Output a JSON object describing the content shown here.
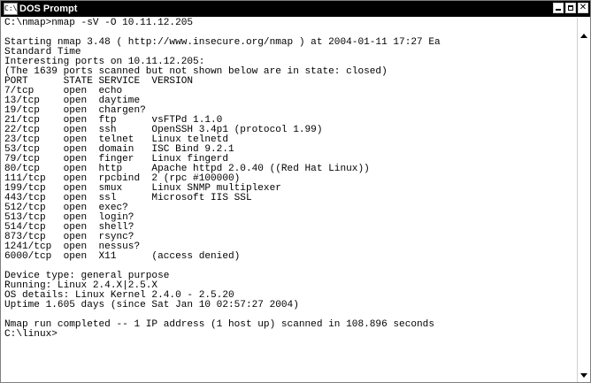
{
  "window": {
    "title": "DOS Prompt",
    "icon_name": "console-icon",
    "icon_glyph": "C:\\"
  },
  "console": {
    "lines": [
      "C:\\nmap>nmap -sV -O 10.11.12.205",
      "",
      "Starting nmap 3.48 ( http://www.insecure.org/nmap ) at 2004-01-11 17:27 Ea",
      "Standard Time",
      "Interesting ports on 10.11.12.205:",
      "(The 1639 ports scanned but not shown below are in state: closed)",
      "PORT      STATE SERVICE  VERSION",
      "7/tcp     open  echo",
      "13/tcp    open  daytime",
      "19/tcp    open  chargen?",
      "21/tcp    open  ftp      vsFTPd 1.1.0",
      "22/tcp    open  ssh      OpenSSH 3.4p1 (protocol 1.99)",
      "23/tcp    open  telnet   Linux telnetd",
      "53/tcp    open  domain   ISC Bind 9.2.1",
      "79/tcp    open  finger   Linux fingerd",
      "80/tcp    open  http     Apache httpd 2.0.40 ((Red Hat Linux))",
      "111/tcp   open  rpcbind  2 (rpc #100000)",
      "199/tcp   open  smux     Linux SNMP multiplexer",
      "443/tcp   open  ssl      Microsoft IIS SSL",
      "512/tcp   open  exec?",
      "513/tcp   open  login?",
      "514/tcp   open  shell?",
      "873/tcp   open  rsync?",
      "1241/tcp  open  nessus?",
      "6000/tcp  open  X11      (access denied)",
      "",
      "Device type: general purpose",
      "Running: Linux 2.4.X|2.5.X",
      "OS details: Linux Kernel 2.4.0 - 2.5.20",
      "Uptime 1.605 days (since Sat Jan 10 02:57:27 2004)",
      "",
      "Nmap run completed -- 1 IP address (1 host up) scanned in 108.896 seconds",
      "C:\\linux>"
    ]
  }
}
